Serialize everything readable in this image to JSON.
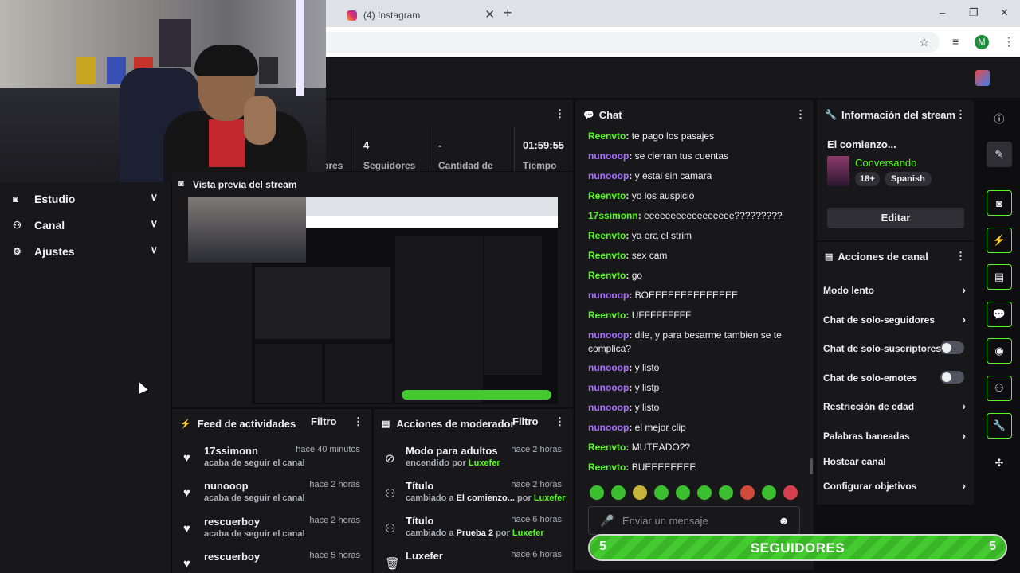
{
  "browser": {
    "tab_title": "(4) Instagram",
    "new_tab": "+",
    "avatar_letter": "M",
    "window_controls": [
      "–",
      "❐",
      "✕"
    ]
  },
  "nav": {
    "items": [
      {
        "label": "Estudio",
        "icon": "studio-icon"
      },
      {
        "label": "Canal",
        "icon": "channel-icon"
      },
      {
        "label": "Ajustes",
        "icon": "gear-icon"
      }
    ]
  },
  "stats": [
    {
      "value": "",
      "label": "ores"
    },
    {
      "value": "4",
      "label": "Seguidores"
    },
    {
      "value": "-",
      "label": "Cantidad de"
    },
    {
      "value": "01:59:55",
      "label": "Tiempo"
    }
  ],
  "preview": {
    "title": "Vista previa del stream"
  },
  "feed": {
    "title": "Feed de actividades",
    "filter": "Filtro",
    "items": [
      {
        "name": "17ssimonn",
        "sub": "acaba de seguir el canal",
        "time": "hace 40 minutos"
      },
      {
        "name": "nunooop",
        "sub": "acaba de seguir el canal",
        "time": "hace 2 horas"
      },
      {
        "name": "rescuerboy",
        "sub": "acaba de seguir el canal",
        "time": "hace 2 horas"
      },
      {
        "name": "rescuerboy",
        "sub": "",
        "time": "hace 5 horas"
      }
    ]
  },
  "modactions": {
    "title": "Acciones de moderador",
    "filter": "Filtro",
    "items": [
      {
        "name": "Modo para adultos",
        "pre": "encendido",
        "mid": "",
        "by": "por",
        "user": "Luxefer",
        "time": "hace 2 horas"
      },
      {
        "name": "Título",
        "pre": "cambiado a",
        "mid": "El comienzo...",
        "by": "por",
        "user": "Luxefer",
        "time": "hace 2 horas"
      },
      {
        "name": "Título",
        "pre": "cambiado a",
        "mid": "Prueba 2",
        "by": "por",
        "user": "Luxefer",
        "time": "hace 6 horas"
      },
      {
        "name": "Luxefer",
        "pre": "",
        "mid": "",
        "by": "",
        "user": "",
        "time": "hace 6 horas"
      }
    ]
  },
  "chat": {
    "title": "Chat",
    "messages": [
      {
        "user": "Reenvto",
        "color": "green",
        "text": "te pago los pasajes"
      },
      {
        "user": "nunooop",
        "color": "purple",
        "text": "se cierran tus cuentas"
      },
      {
        "user": "nunooop",
        "color": "purple",
        "text": "y estai sin camara"
      },
      {
        "user": "Reenvto",
        "color": "green",
        "text": "yo los auspicio"
      },
      {
        "user": "17ssimonn",
        "color": "green",
        "text": "eeeeeeeeeeeeeeeee?????????"
      },
      {
        "user": "Reenvto",
        "color": "green",
        "text": "ya era el strim"
      },
      {
        "user": "Reenvto",
        "color": "green",
        "text": "sex cam"
      },
      {
        "user": "Reenvto",
        "color": "green",
        "text": "go"
      },
      {
        "user": "nunooop",
        "color": "purple",
        "text": "BOEEEEEEEEEEEEEE"
      },
      {
        "user": "Reenvto",
        "color": "green",
        "text": "UFFFFFFFFF"
      },
      {
        "user": "nunooop",
        "color": "purple",
        "text": "dile, y para besarme tambien se te complica?"
      },
      {
        "user": "nunooop",
        "color": "purple",
        "text": "y listo"
      },
      {
        "user": "nunooop",
        "color": "purple",
        "text": "y listp"
      },
      {
        "user": "nunooop",
        "color": "purple",
        "text": "y listo"
      },
      {
        "user": "nunooop",
        "color": "purple",
        "text": "el mejor clip"
      },
      {
        "user": "Reenvto",
        "color": "green",
        "text": "MUTEADO??"
      },
      {
        "user": "Reenvto",
        "color": "green",
        "text": "BUEEEEEEEE"
      }
    ],
    "input_placeholder": "Enviar un mensaje"
  },
  "info": {
    "title": "Información del stream",
    "stream_title": "El comienzo...",
    "category": "Conversando",
    "badges": [
      "18+",
      "Spanish"
    ],
    "edit": "Editar"
  },
  "channel_actions": {
    "title": "Acciones de canal",
    "items": [
      {
        "label": "Modo lento",
        "control": "arrow"
      },
      {
        "label": "Chat de solo-seguidores",
        "control": "arrow"
      },
      {
        "label": "Chat de solo-suscriptores",
        "control": "toggle"
      },
      {
        "label": "Chat de solo-emotes",
        "control": "toggle"
      },
      {
        "label": "Restricción de edad",
        "control": "arrow"
      },
      {
        "label": "Palabras baneadas",
        "control": "arrow"
      },
      {
        "label": "Hostear canal",
        "control": "none"
      },
      {
        "label": "Configurar objetivos",
        "control": "arrow"
      }
    ]
  },
  "goal": {
    "current": "5",
    "label": "SEGUIDORES",
    "target": "5",
    "progress": 1.0
  },
  "colors": {
    "accent": "#53fc18",
    "purple": "#a970ff",
    "panel": "#18181b",
    "bg": "#0e0e10"
  }
}
